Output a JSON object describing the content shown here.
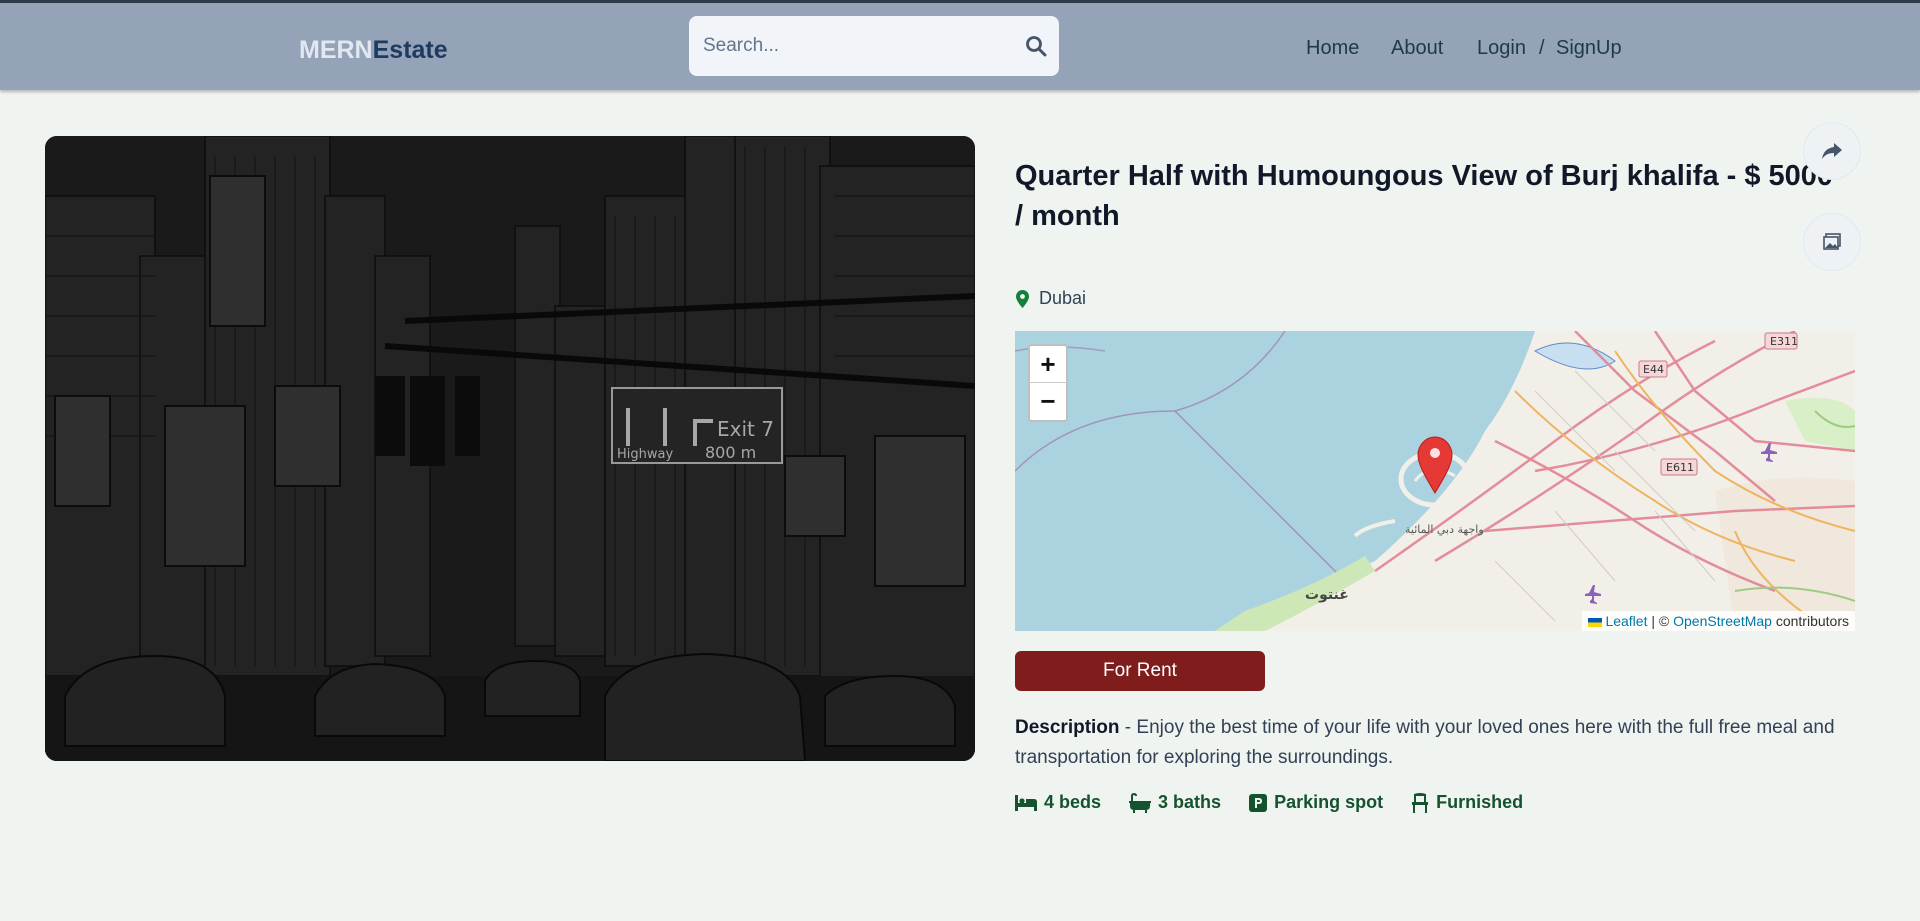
{
  "header": {
    "logo_part1": "MERN",
    "logo_part2": "Estate",
    "search_placeholder": "Search...",
    "nav": {
      "home": "Home",
      "about": "About",
      "login": "Login",
      "sep": "/",
      "signup": "SignUp"
    }
  },
  "listing": {
    "title": "Quarter Half with Humoungous View of Burj khalifa - $ 5000 / month",
    "location": "Dubai",
    "badge": "For Rent",
    "description_label": "Description",
    "description_text": " - Enjoy the best time of your life with your loved ones here with the full free meal and transportation for exploring the surroundings.",
    "features": [
      {
        "icon": "bed-icon",
        "label": "4 beds"
      },
      {
        "icon": "bath-icon",
        "label": "3 baths"
      },
      {
        "icon": "parking-icon",
        "label": "Parking spot"
      },
      {
        "icon": "chair-icon",
        "label": "Furnished"
      }
    ]
  },
  "map": {
    "zoom_in": "+",
    "zoom_out": "−",
    "attribution_leaflet": "Leaflet",
    "attribution_mid": " | © ",
    "attribution_osm": "OpenStreetMap",
    "attribution_end": " contributors",
    "labels": {
      "e311": "E311",
      "e44": "E44",
      "e611": "E611",
      "palm": "واجهة دبي المائية",
      "ghantoot": "غنتوت"
    }
  },
  "colors": {
    "header": "#94a3b8",
    "badge": "#7f1d1d",
    "feature": "#14532d",
    "page_bg": "#f0f4f0"
  }
}
